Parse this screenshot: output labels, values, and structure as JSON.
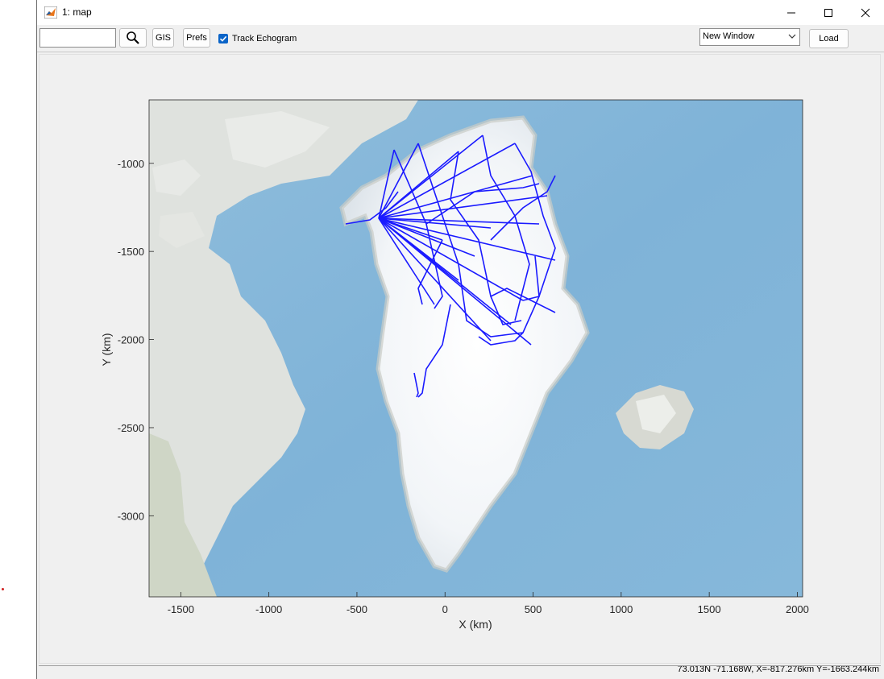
{
  "window": {
    "title": "1: map"
  },
  "toolbar": {
    "search_value": "",
    "gis_label": "GIS",
    "prefs_label": "Prefs",
    "track_echogram_label": "Track Echogram",
    "track_echogram_checked": true,
    "window_select_value": "New Window",
    "load_label": "Load"
  },
  "axes": {
    "xlabel": "X (km)",
    "ylabel": "Y (km)",
    "xticks": [
      "-1500",
      "-1000",
      "-500",
      "0",
      "500",
      "1000",
      "1500",
      "2000"
    ],
    "yticks": [
      "-1000",
      "-1500",
      "-2000",
      "-2500",
      "-3000"
    ],
    "xlim": [
      -1680,
      2030
    ],
    "ylim": [
      -3460,
      -640
    ],
    "track_color": "#1a1aff"
  },
  "status": {
    "text": "73.013N -71.168W, X=-817.276km Y=-1663.244km"
  }
}
